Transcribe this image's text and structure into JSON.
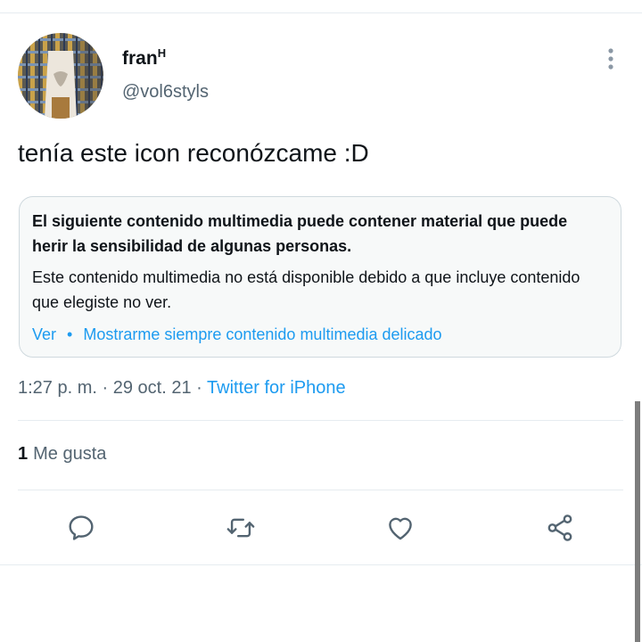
{
  "tweet": {
    "display_name": "fran",
    "display_name_sup": "H",
    "handle": "@vol6styls",
    "text": "tenía este icon reconózcame :D",
    "sensitive_warning": {
      "title": "El siguiente contenido multimedia puede contener material que puede herir la sensibilidad de algunas personas.",
      "body": "Este contenido multimedia no está disponible debido a que incluye contenido que elegiste no ver.",
      "view_label": "Ver",
      "separator": "•",
      "always_show_label": "Mostrarme siempre contenido multimedia delicado"
    },
    "time": "1:27 p. m.",
    "date": "29 oct. 21",
    "meta_separator": "·",
    "source": "Twitter for iPhone",
    "likes_count": "1",
    "likes_label": "Me gusta"
  },
  "actions": {
    "reply_icon": "speech-bubble-icon",
    "retweet_icon": "retweet-arrows-icon",
    "like_icon": "heart-icon",
    "share_icon": "share-nodes-icon"
  },
  "colors": {
    "text_primary": "#0f1419",
    "text_secondary": "#536471",
    "accent": "#1d9bf0",
    "divider": "#e6ecf0"
  }
}
